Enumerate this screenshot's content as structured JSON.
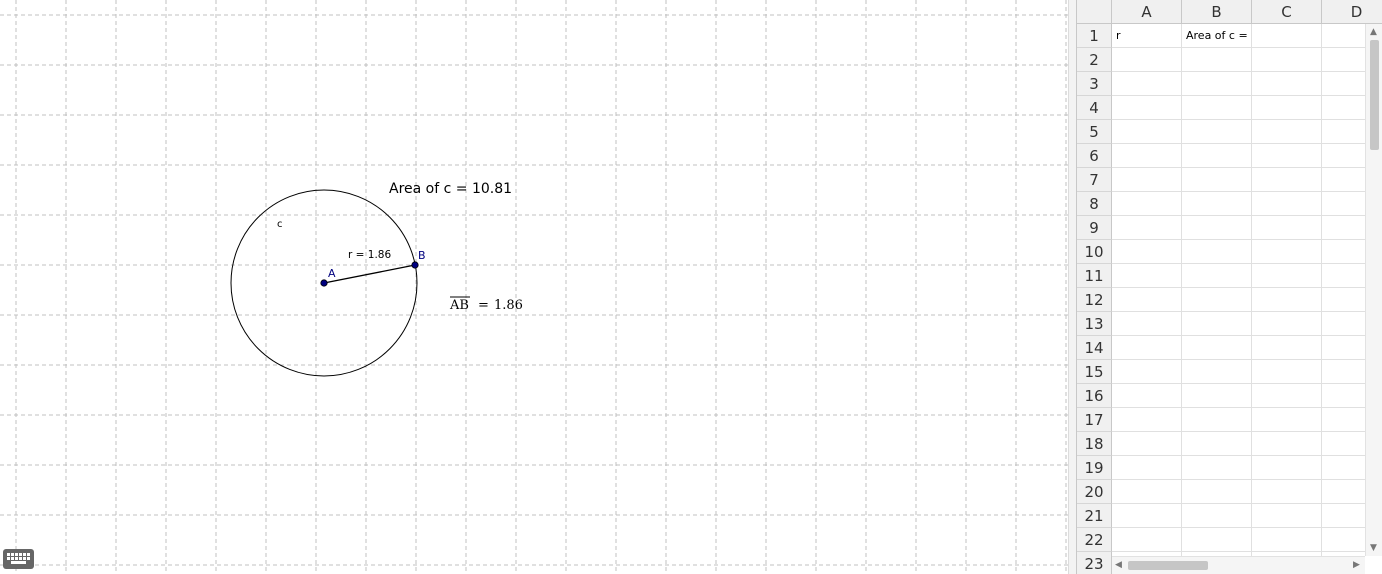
{
  "graphics": {
    "area_text": "Area of c = 10.81",
    "circle_label": "c",
    "radius_label": "r = 1.86",
    "point_a_label": "A",
    "point_b_label": "B",
    "segment_name": "AB",
    "segment_equals": "=",
    "segment_value": "1.86",
    "point_color": "#00007f"
  },
  "spreadsheet": {
    "columns": [
      "A",
      "B",
      "C",
      "D"
    ],
    "rows": [
      "1",
      "2",
      "3",
      "4",
      "5",
      "6",
      "7",
      "8",
      "9",
      "10",
      "11",
      "12",
      "13",
      "14",
      "15",
      "16",
      "17",
      "18",
      "19",
      "20",
      "21",
      "22",
      "23"
    ],
    "cells": {
      "A1": "r",
      "B1": "Area of c ="
    }
  },
  "controls": {
    "keyboard_icon": "keyboard-icon",
    "scroll_up_icon": "chevron-up-icon",
    "scroll_down_icon": "chevron-down-icon",
    "scroll_left_icon": "chevron-left-icon",
    "scroll_right_icon": "chevron-right-icon"
  }
}
